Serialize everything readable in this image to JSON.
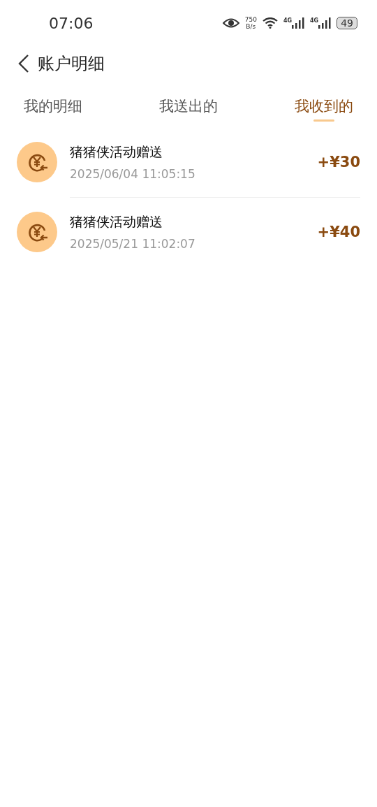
{
  "status_bar": {
    "time": "07:06",
    "speed_value": "750",
    "speed_unit": "B/s",
    "networks": [
      "4G",
      "4G"
    ],
    "battery": "49"
  },
  "header": {
    "title": "账户明细"
  },
  "tabs": [
    {
      "label": "我的明细",
      "selected": false
    },
    {
      "label": "我送出的",
      "selected": false
    },
    {
      "label": "我收到的",
      "selected": true
    }
  ],
  "records": [
    {
      "title": "猪猪侠活动赠送",
      "time": "2025/06/04 11:05:15",
      "amount": "+¥30"
    },
    {
      "title": "猪猪侠活动赠送",
      "time": "2025/05/21 11:02:07",
      "amount": "+¥40"
    }
  ]
}
